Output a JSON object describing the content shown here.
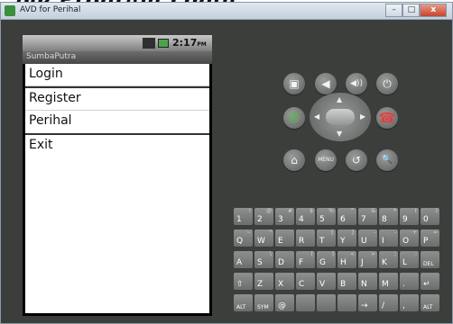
{
  "heading": "ple Program Login",
  "window": {
    "title": "AVD for Perihal",
    "buttons": [
      "–",
      "□",
      "x"
    ]
  },
  "phone": {
    "status_time": "2:17",
    "status_ampm": "PM",
    "app_title": "SumbaPutra",
    "menu": [
      "Login",
      "Register",
      "Perihal",
      "Exit"
    ]
  },
  "controls": {
    "row1": [
      {
        "name": "camera-button",
        "glyph": "▣"
      },
      {
        "name": "volume-down-button",
        "glyph": "◀"
      },
      {
        "name": "volume-up-button",
        "glyph": "◀))"
      },
      {
        "name": "power-button",
        "glyph": "⏻"
      }
    ],
    "call_glyph": "✆",
    "end_glyph": "☎",
    "row3": [
      {
        "name": "home-button",
        "glyph": "⌂"
      },
      {
        "name": "menu-button",
        "glyph": "MENU"
      },
      {
        "name": "back-button",
        "glyph": "↺"
      },
      {
        "name": "search-button",
        "glyph": "🔍"
      }
    ],
    "dpad_arrows": [
      "▲",
      "▼",
      "◀",
      "▶"
    ]
  },
  "keyboard": {
    "rows": [
      [
        [
          "1",
          "!"
        ],
        [
          "2",
          "@"
        ],
        [
          "3",
          "#"
        ],
        [
          "4",
          "$"
        ],
        [
          "5",
          "%"
        ],
        [
          "6",
          "^"
        ],
        [
          "7",
          "&"
        ],
        [
          "8",
          "*"
        ],
        [
          "9",
          "("
        ],
        [
          "0",
          ")"
        ]
      ],
      [
        [
          "Q",
          "~"
        ],
        [
          "W",
          "\""
        ],
        [
          "E",
          ""
        ],
        [
          "R",
          ""
        ],
        [
          "T",
          "{"
        ],
        [
          "Y",
          "}"
        ],
        [
          "U",
          "-"
        ],
        [
          "I",
          "-"
        ],
        [
          "O",
          "+"
        ],
        [
          "P",
          "="
        ]
      ],
      [
        [
          "A",
          ""
        ],
        [
          "S",
          "\\"
        ],
        [
          "D",
          ""
        ],
        [
          "F",
          "["
        ],
        [
          "G",
          "]"
        ],
        [
          "H",
          "<"
        ],
        [
          "J",
          ">"
        ],
        [
          "K",
          ";"
        ],
        [
          "L",
          ":"
        ],
        [
          "DEL",
          ""
        ]
      ],
      [
        [
          "⇧",
          ""
        ],
        [
          "Z",
          ""
        ],
        [
          "X",
          ""
        ],
        [
          "C",
          ""
        ],
        [
          "V",
          ""
        ],
        [
          "B",
          ""
        ],
        [
          "N",
          ""
        ],
        [
          "M",
          ""
        ],
        [
          ".",
          ""
        ],
        [
          "↵",
          ""
        ]
      ],
      [
        [
          "ALT",
          ""
        ],
        [
          "SYM",
          ""
        ],
        [
          "@",
          ""
        ],
        [
          "",
          ""
        ],
        [
          "",
          ""
        ],
        [
          "",
          ""
        ],
        [
          "→",
          ""
        ],
        [
          "/",
          ""
        ],
        [
          ",",
          ""
        ],
        [
          "ALT",
          ""
        ]
      ]
    ]
  }
}
